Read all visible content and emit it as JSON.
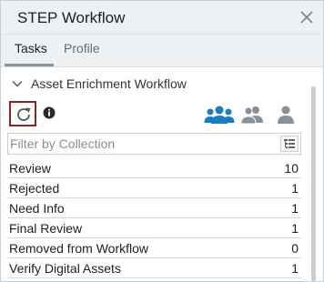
{
  "header": {
    "title": "STEP Workflow"
  },
  "tabs": [
    {
      "label": "Tasks",
      "active": true
    },
    {
      "label": "Profile",
      "active": false
    }
  ],
  "section": {
    "title": "Asset Enrichment Workflow",
    "expanded": true
  },
  "toolbar": {
    "accent_color": "#1a7dc4",
    "inactive_icon_color": "#8a9097",
    "refresh_border_color": "#8b2323"
  },
  "filter": {
    "placeholder": "Filter by Collection",
    "value": ""
  },
  "rows": [
    {
      "label": "Review",
      "count": "10"
    },
    {
      "label": "Rejected",
      "count": "1"
    },
    {
      "label": "Need Info",
      "count": "1"
    },
    {
      "label": "Final Review",
      "count": "1"
    },
    {
      "label": "Removed from Workflow",
      "count": "0"
    },
    {
      "label": "Verify Digital Assets",
      "count": "1"
    }
  ]
}
